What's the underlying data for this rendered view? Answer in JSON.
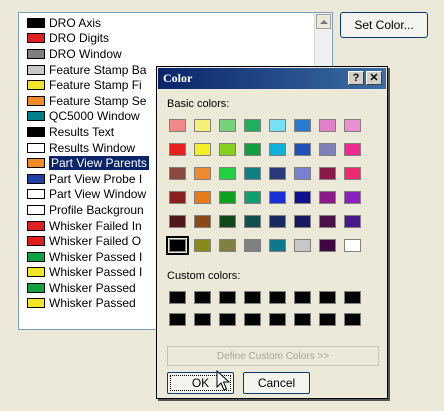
{
  "list": {
    "items": [
      {
        "label": "DRO Axis",
        "color": "#000000"
      },
      {
        "label": "DRO Digits",
        "color": "#e02020"
      },
      {
        "label": "DRO Window",
        "color": "#7f7f7f"
      },
      {
        "label": "Feature Stamp Ba",
        "color": "#c8c8c8"
      },
      {
        "label": "Feature Stamp Fi",
        "color": "#f2e42a"
      },
      {
        "label": "Feature Stamp Se",
        "color": "#f08a24"
      },
      {
        "label": "QC5000 Window",
        "color": "#00808a"
      },
      {
        "label": "Results Text",
        "color": "#000000"
      },
      {
        "label": "Results Window",
        "color": "#ffffff"
      },
      {
        "label": "Part View Parents",
        "color": "#f08a24",
        "selected": true
      },
      {
        "label": "Part View Probe I",
        "color": "#1f3fa6"
      },
      {
        "label": "Part View Window",
        "color": "#ffffff"
      },
      {
        "label": "Profile Backgroun",
        "color": "#ffffff"
      },
      {
        "label": "Whisker Failed In",
        "color": "#e02020"
      },
      {
        "label": "Whisker Failed O",
        "color": "#e02020"
      },
      {
        "label": "Whisker Passed I",
        "color": "#10a040"
      },
      {
        "label": "Whisker Passed I",
        "color": "#f2e42a"
      },
      {
        "label": "Whisker Passed",
        "color": "#10a040"
      },
      {
        "label": "Whisker Passed",
        "color": "#f2e42a"
      }
    ]
  },
  "buttons": {
    "set_color": "Set Color..."
  },
  "dialog": {
    "title": "Color",
    "help_glyph": "?",
    "close_glyph": "✕",
    "basic_label": "Basic colors:",
    "custom_label": "Custom colors:",
    "define_label": "Define Custom Colors >>",
    "ok_label": "OK",
    "cancel_label": "Cancel",
    "selected_basic_index": 40,
    "basic_colors": [
      "#f08a8a",
      "#f5f07a",
      "#78d078",
      "#20b060",
      "#78e0f0",
      "#2a7ad0",
      "#e080c8",
      "#e890d0",
      "#e82020",
      "#f2ee28",
      "#88d020",
      "#10a040",
      "#10b0d8",
      "#2050b8",
      "#8080b8",
      "#f02a90",
      "#8a4a40",
      "#f08a30",
      "#20d040",
      "#108080",
      "#2a3a78",
      "#7880d0",
      "#8a1a4a",
      "#f02a70",
      "#8a2020",
      "#e87a18",
      "#10a020",
      "#10a070",
      "#1a30d8",
      "#101090",
      "#8a1a8a",
      "#8a20c0",
      "#501818",
      "#8a4a18",
      "#104818",
      "#105050",
      "#182a60",
      "#181860",
      "#4a104a",
      "#4a1a8a",
      "#000000",
      "#8a8a18",
      "#808040",
      "#808080",
      "#10788a",
      "#c8c8c8",
      "#400840",
      "#ffffff"
    ],
    "custom_colors": [
      "#000000",
      "#000000",
      "#000000",
      "#000000",
      "#000000",
      "#000000",
      "#000000",
      "#000000",
      "#000000",
      "#000000",
      "#000000",
      "#000000",
      "#000000",
      "#000000",
      "#000000",
      "#000000"
    ]
  },
  "icons": {
    "scroll_up": "scroll-up-arrow-icon",
    "cursor": "mouse-pointer-icon"
  }
}
